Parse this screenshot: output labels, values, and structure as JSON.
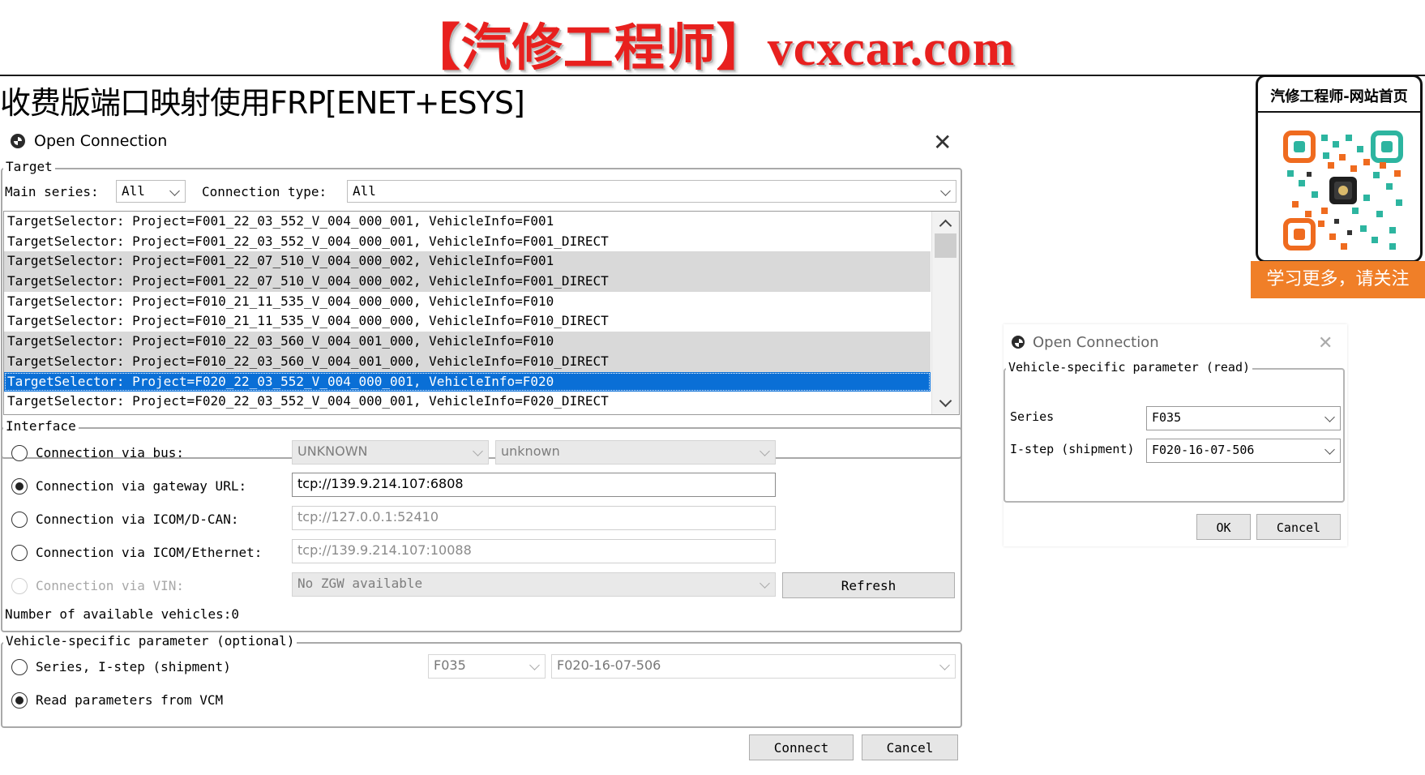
{
  "banner": {
    "title": "【汽修工程师】vcxcar.com",
    "heading": "收费版端口映射使用FRP[ENET+ESYS]"
  },
  "qr_card": {
    "title": "汽修工程师-网站首页",
    "footer": "学习更多，请关注"
  },
  "main_dialog": {
    "title": "Open Connection",
    "target": {
      "legend": "Target",
      "main_series_label": "Main series:",
      "main_series_value": "All",
      "connection_type_label": "Connection type:",
      "connection_type_value": "All",
      "rows": [
        "TargetSelector: Project=F001_22_03_552_V_004_000_001, VehicleInfo=F001",
        "TargetSelector: Project=F001_22_03_552_V_004_000_001, VehicleInfo=F001_DIRECT",
        "TargetSelector: Project=F001_22_07_510_V_004_000_002, VehicleInfo=F001",
        "TargetSelector: Project=F001_22_07_510_V_004_000_002, VehicleInfo=F001_DIRECT",
        "TargetSelector: Project=F010_21_11_535_V_004_000_000, VehicleInfo=F010",
        "TargetSelector: Project=F010_21_11_535_V_004_000_000, VehicleInfo=F010_DIRECT",
        "TargetSelector: Project=F010_22_03_560_V_004_001_000, VehicleInfo=F010",
        "TargetSelector: Project=F010_22_03_560_V_004_001_000, VehicleInfo=F010_DIRECT",
        "TargetSelector: Project=F020_22_03_552_V_004_000_001, VehicleInfo=F020",
        "TargetSelector: Project=F020_22_03_552_V_004_000_001, VehicleInfo=F020_DIRECT"
      ],
      "selected_index": 8
    },
    "interface": {
      "legend": "Interface",
      "bus_label": "Connection via bus:",
      "bus_value1": "UNKNOWN",
      "bus_value2": "unknown",
      "gateway_label": "Connection via gateway URL:",
      "gateway_value": "tcp://139.9.214.107:6808",
      "icom_dcan_label": "Connection via ICOM/D-CAN:",
      "icom_dcan_value": "tcp://127.0.0.1:52410",
      "icom_eth_label": "Connection via ICOM/Ethernet:",
      "icom_eth_value": "tcp://139.9.214.107:10088",
      "vin_label": "Connection via VIN:",
      "vin_value": "No ZGW available",
      "refresh_label": "Refresh",
      "available_label": "Number of available vehicles:0"
    },
    "vehicle_params": {
      "legend": "Vehicle-specific parameter (optional)",
      "series_istep_label": "Series, I-step (shipment)",
      "series_value": "F035",
      "istep_value": "F020-16-07-506",
      "read_vcm_label": "Read parameters from VCM"
    },
    "connect_label": "Connect",
    "cancel_label": "Cancel"
  },
  "read_dialog": {
    "title": "Open Connection",
    "legend": "Vehicle-specific parameter (read)",
    "series_label": "Series",
    "series_value": "F035",
    "istep_label": "I-step (shipment)",
    "istep_value": "F020-16-07-506",
    "ok_label": "OK",
    "cancel_label": "Cancel"
  },
  "colors": {
    "banner_red": "#e8201e",
    "selection_blue": "#0a6fd6",
    "alt_row_gray": "#d9d9d9",
    "qr_footer_orange": "#f07f28"
  }
}
